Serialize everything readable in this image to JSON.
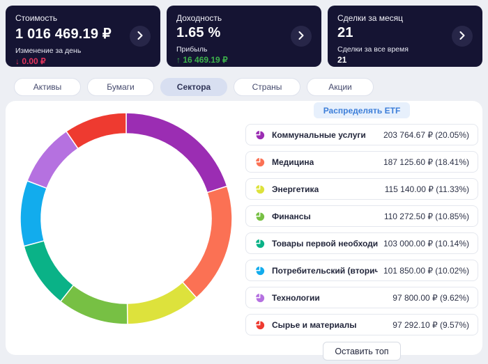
{
  "cards": [
    {
      "title": "Стоимость",
      "value": "1 016 469.19 ₽",
      "sub_label": "Изменение за день",
      "sub_value": "↓ 0.00 ₽",
      "sub_color": "#e5345c"
    },
    {
      "title": "Доходность",
      "value": "1.65 %",
      "sub_label": "Прибыль",
      "sub_value": "↑ 16 469.19 ₽",
      "sub_color": "#3db34c"
    },
    {
      "title": "Сделки за месяц",
      "value": "21",
      "sub_label": "Сделки за все время",
      "sub_value": "21",
      "sub_color": "#ffffff"
    }
  ],
  "tabs": [
    {
      "label": "Активы",
      "active": false
    },
    {
      "label": "Бумаги",
      "active": false
    },
    {
      "label": "Сектора",
      "active": true
    },
    {
      "label": "Страны",
      "active": false
    },
    {
      "label": "Акции",
      "active": false
    }
  ],
  "etf_button": "Распределять ETF",
  "top_button": "Оставить топ",
  "sectors": [
    {
      "label": "Коммунальные услуги",
      "value": "203 764.67 ₽ (20.05%)",
      "color": "#9b2db3"
    },
    {
      "label": "Медицина",
      "value": "187 125.60 ₽ (18.41%)",
      "color": "#fb7154"
    },
    {
      "label": "Энергетика",
      "value": "115 140.00 ₽ (11.33%)",
      "color": "#dde23c"
    },
    {
      "label": "Финансы",
      "value": "110 272.50 ₽ (10.85%)",
      "color": "#77c044"
    },
    {
      "label": "Товары первой необходим...",
      "value": "103 000.00 ₽ (10.14%)",
      "color": "#0ab287"
    },
    {
      "label": "Потребительский (вторичн...",
      "value": "101 850.00 ₽ (10.02%)",
      "color": "#12aced"
    },
    {
      "label": "Технологии",
      "value": "97 800.00 ₽ (9.62%)",
      "color": "#b571e0"
    },
    {
      "label": "Сырье и материалы",
      "value": "97 292.10 ₽ (9.57%)",
      "color": "#ee3a30"
    }
  ],
  "chart_data": {
    "type": "pie",
    "title": "Сектора портфеля",
    "categories": [
      "Коммунальные услуги",
      "Медицина",
      "Энергетика",
      "Финансы",
      "Товары первой необходимости",
      "Потребительский (вторичный)",
      "Технологии",
      "Сырье и материалы"
    ],
    "values": [
      20.05,
      18.41,
      11.33,
      10.85,
      10.14,
      10.02,
      9.62,
      9.57
    ],
    "amounts_rub": [
      203764.67,
      187125.6,
      115140.0,
      110272.5,
      103000.0,
      101850.0,
      97800.0,
      97292.1
    ],
    "colors": [
      "#9b2db3",
      "#fb7154",
      "#dde23c",
      "#77c044",
      "#0ab287",
      "#12aced",
      "#b571e0",
      "#ee3a30"
    ],
    "start_angle_deg": 0,
    "direction": "clockwise",
    "donut": true,
    "legend_position": "right-list"
  }
}
